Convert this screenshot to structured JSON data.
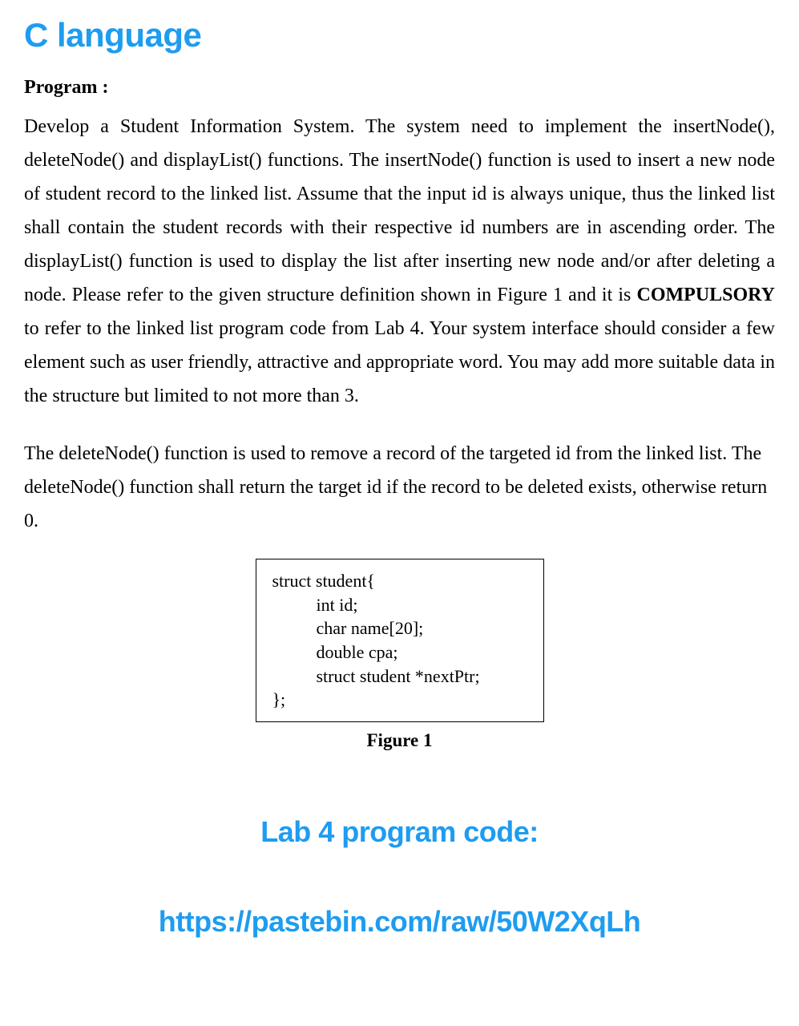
{
  "title": "C language",
  "sectionLabel": "Program :",
  "para1_part1": "Develop a Student Information System. The system need to implement the insertNode(), deleteNode() and displayList() functions. The insertNode() function is used to insert a new node of student record to the  linked list. Assume that the input id is always unique, thus the linked list shall contain the student records with their respective id numbers are in ascending order. The displayList() function is used to display the list after inserting new node and/or after deleting a node. Please refer to the given structure definition shown in Figure 1 and it is ",
  "para1_bold": "COMPULSORY",
  "para1_part2": " to refer to the linked list program code from Lab 4.  Your system interface should consider a few element such as user friendly, attractive and appropriate word.  You may add more suitable data in the structure but limited to not more than 3.",
  "para2": "The deleteNode() function is used to remove a record of the targeted id from the linked list. The deleteNode() function shall return the target id if the record to be deleted exists, otherwise return 0.",
  "code": {
    "l1": "struct student{",
    "l2": "          int id;",
    "l3": "          char name[20];",
    "l4": "          double cpa;",
    "l5": "          struct student *nextPtr;",
    "l6": "};"
  },
  "figureCaption": "Figure 1",
  "labTitle": "Lab 4 program code:",
  "url": "https://pastebin.com/raw/50W2XqLh"
}
